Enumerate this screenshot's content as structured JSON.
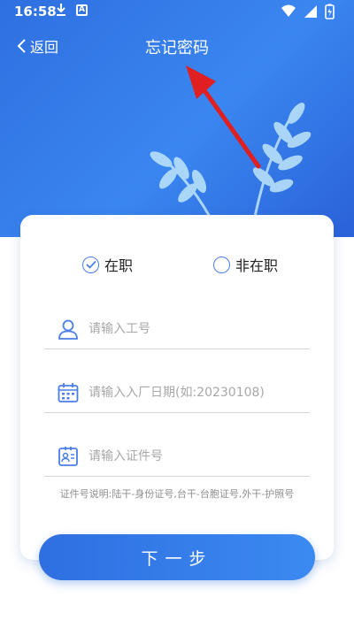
{
  "status_bar": {
    "time": "16:58",
    "app_badge": "A"
  },
  "nav": {
    "back_label": "返回",
    "title": "忘记密码"
  },
  "form": {
    "radio_options": [
      {
        "label": "在职",
        "checked": true
      },
      {
        "label": "非在职",
        "checked": false
      }
    ],
    "fields": [
      {
        "placeholder": "请输入工号",
        "icon": "user-icon"
      },
      {
        "placeholder": "请输入入厂日期(如:20230108)",
        "icon": "calendar-icon"
      },
      {
        "placeholder": "请输入证件号",
        "icon": "id-card-icon"
      }
    ],
    "note": "证件号说明:陆干-身份证号,台干-台胞证号,外干-护照号",
    "submit_label": "下一步"
  },
  "colors": {
    "primary": "#2f6fe0",
    "placeholder": "#a8a8a8",
    "annotation_arrow": "#e02020"
  }
}
